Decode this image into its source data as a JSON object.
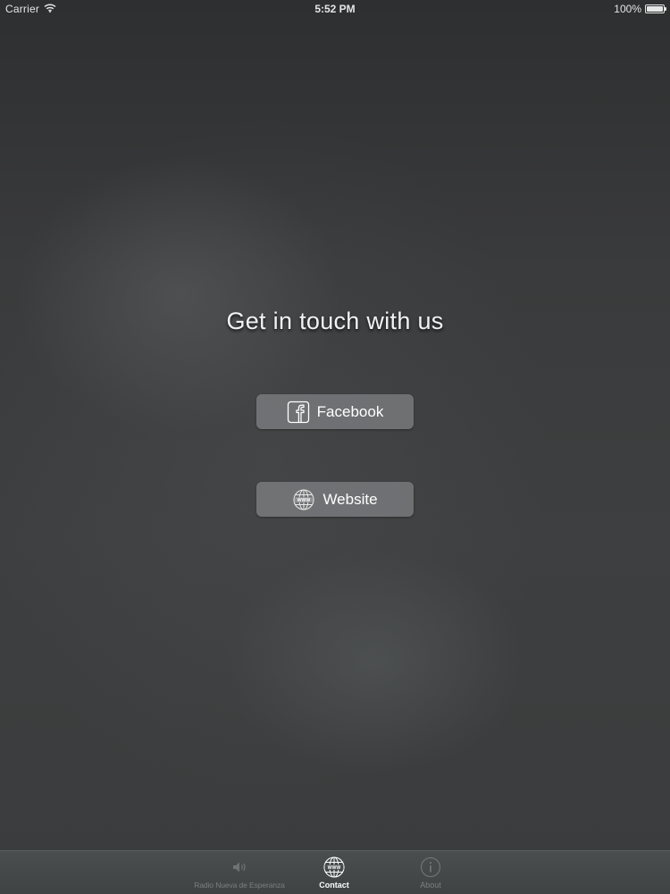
{
  "status_bar": {
    "carrier": "Carrier",
    "time": "5:52 PM",
    "battery": "100%"
  },
  "main": {
    "heading": "Get in touch with us",
    "buttons": {
      "facebook": {
        "label": "Facebook",
        "icon": "facebook-icon"
      },
      "website": {
        "label": "Website",
        "icon": "globe-www-icon"
      }
    }
  },
  "tab_bar": {
    "items": [
      {
        "label": "Radio Nueva de Esperanza",
        "icon": "speaker-icon",
        "selected": false
      },
      {
        "label": "Contact",
        "icon": "globe-www-icon",
        "selected": true
      },
      {
        "label": "About",
        "icon": "info-icon",
        "selected": false
      }
    ]
  },
  "colors": {
    "background": "#3b3c3d",
    "button_fill": "#8a8c8e",
    "text": "#ffffff",
    "tab_inactive": "#7b7f80",
    "tab_active": "#ffffff"
  }
}
